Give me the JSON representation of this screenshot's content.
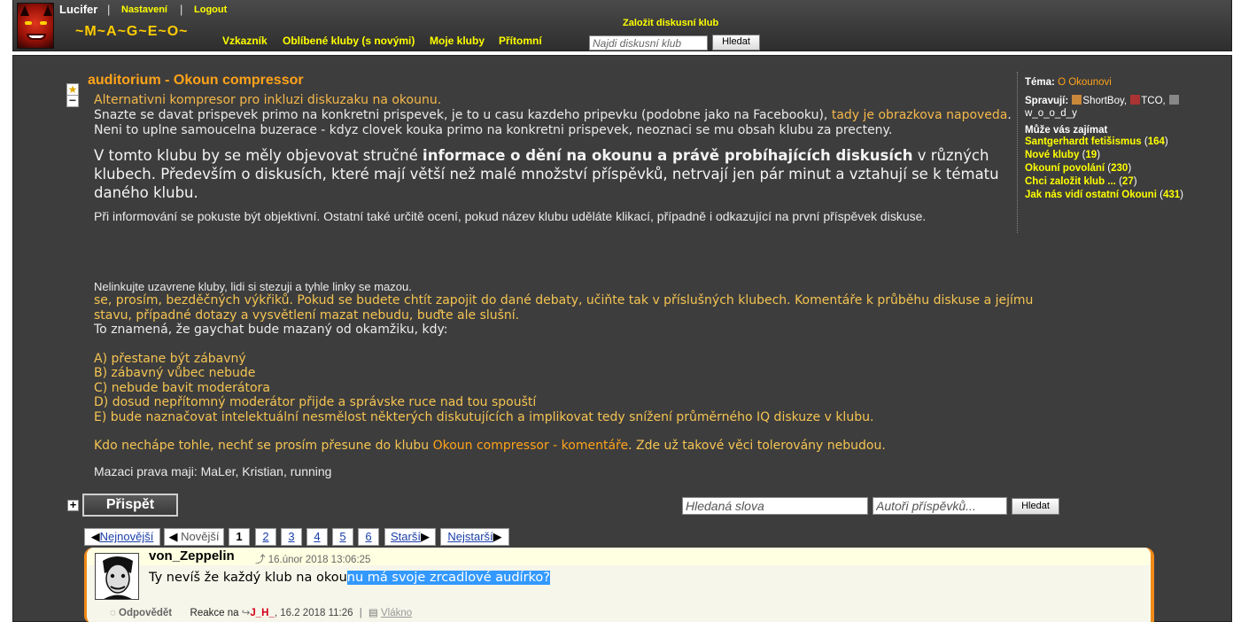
{
  "header": {
    "username": "Lucifer",
    "settings": "Nastavení",
    "logout": "Logout",
    "slogan": "~M~A~G~E~O~",
    "nav": [
      "Vzkazník",
      "Oblíbené kluby  (s novými)",
      "Moje kluby",
      "Přítomní"
    ],
    "create_club": "Založit diskusní klub",
    "search_placeholder": "Najdi diskusní klub",
    "search_button": "Hledat"
  },
  "club": {
    "title": "auditorium - Okoun compressor",
    "subtitle": "Alternativni kompresor pro inkluzi diskuzaku na okounu.",
    "desc_part1": "Snazte se davat prispevek primo na konkretni prispevek, je to u casu kazdeho pripevku (podobne jako na Facebooku), ",
    "desc_link": "tady je obrazkova napoveda",
    "desc_part2": ". Neni to uplne samoucelna buzerace - kdyz clovek kouka primo na konkretni prispevek, neoznaci se mu obsah klubu za precteny.",
    "big_part1": "V tomto klubu by se měly objevovat stručné ",
    "big_bold": "informace o dění na okounu a právě probíhajících diskusích",
    "big_part2": " v různých klubech. Především o diskusích, které mají větší než malé množství příspěvků, netrvají jen pár minut a vztahují se k tématu daného klubu.",
    "objective": "Při informování se pokuste být objektivní. Ostatní také určitě ocení, pokud název klubu uděláte klikací, případně i odkazující na první příspěvek diskuse.",
    "nolink": "Nelinkujte uzavrene kluby, lidi si stezuji a tyhle linky se mazou.",
    "rules_y1": "se, prosím, bezděčných výkřiků. Pokud se budete chtít zapojit do dané debaty, učiňte tak v příslušných klubech. Komentáře k průběhu diskuse a jejímu stavu, případné dotazy a vysvětlení mazat nebudu, buďte ale slušní.",
    "rules_w1": "To znamená, že gaychat bude mazaný od okamžiku, kdy:",
    "rule_a": "A) přestane být zábavný",
    "rule_b": "B) zábavný vůbec nebude",
    "rule_c": "C) nebude bavit moderátora",
    "rule_d": "D) dosud nepřítomný moderátor přijde a správske ruce nad tou spouští",
    "rule_e": "E) bude naznačovat intelektuální nesmělost některých diskutujících a implikovat tedy snížení průměrného IQ diskuze v klubu.",
    "kdo_part1": "Kdo nechápe tohle, nechť se prosím přesune do klubu ",
    "kdo_link": "Okoun compressor - komentáře",
    "kdo_part2": ". Zde už takové věci tolerovány nebudou.",
    "mazaci": "Mazaci prava maji: MaLer, Kristian, running"
  },
  "sidebar": {
    "tema_label": "Téma:",
    "tema_value": "O Okounovi",
    "spravuji_label": "Spravují:",
    "admins": [
      "ShortBoy,",
      "TCO,",
      "w_o_o_d_y"
    ],
    "interest_label": "Může vás zajímat",
    "interests": [
      {
        "name": "Santgerhardt fetišismus",
        "count": "164"
      },
      {
        "name": "Nové kluby",
        "count": "19"
      },
      {
        "name": "Okouní povolání",
        "count": "230"
      },
      {
        "name": "Chci založit klub ...",
        "count": "27"
      },
      {
        "name": "Jak nás vidí ostatní Okouni",
        "count": "431"
      }
    ]
  },
  "controls": {
    "plus": "+",
    "contribute": "Přispět",
    "words_placeholder": "Hledaná slova",
    "authors_placeholder": "Autoři příspěvků...",
    "search_button": "Hledat"
  },
  "pager": {
    "newest": "Nejnovější",
    "newer": "Novější",
    "pages": [
      "1",
      "2",
      "3",
      "4",
      "5",
      "6"
    ],
    "older": "Starší",
    "oldest": "Nejstarší"
  },
  "post": {
    "author": "von_Zeppelin",
    "time": "16.únor 2018 13:06:25",
    "text_plain": "Ty nevíš že každý klub na okou",
    "text_selected": "nu má svoje zrcadlové audírko?",
    "reply": "Odpovědět",
    "reaction_label": "Reakce na",
    "reaction_user": "J_H_",
    "reaction_time": ", 16.2 2018 11:26",
    "thread": "Vlákno"
  },
  "colors": {
    "panel": "#3d3d3d",
    "accent_orange": "#ffa31a",
    "accent_yellow": "#ffff00",
    "post_border": "#f08a18"
  }
}
